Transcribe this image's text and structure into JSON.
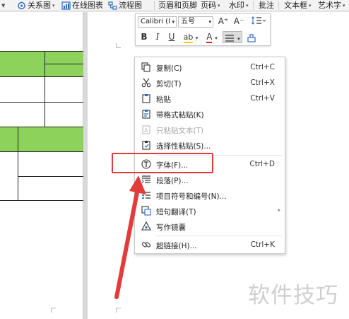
{
  "ribbon": {
    "items": [
      {
        "label": "",
        "icon": "caret-icon"
      },
      {
        "label": "关系图",
        "icon": "relation-graph-icon"
      },
      {
        "label": "在线图表",
        "icon": "online-chart-icon"
      },
      {
        "label": "流程图",
        "icon": "flowchart-icon"
      },
      {
        "label": "页眉和页脚",
        "icon": ""
      },
      {
        "label": "页码",
        "icon": ""
      },
      {
        "label": "水印",
        "icon": ""
      },
      {
        "label": "批注",
        "icon": ""
      },
      {
        "label": "文本框",
        "icon": ""
      },
      {
        "label": "艺术字",
        "icon": ""
      }
    ]
  },
  "mini_toolbar": {
    "font_name": "Calibri (I",
    "font_size": "五号",
    "buttons": {
      "grow": "A⁺",
      "shrink": "A⁻",
      "bold": "B",
      "italic": "I",
      "underline": "U",
      "highlight": "ab",
      "font_color": "A"
    }
  },
  "context_menu": {
    "items": [
      {
        "label": "复制(C)",
        "shortcut": "Ctrl+C",
        "icon": "copy-icon",
        "enabled": true
      },
      {
        "label": "剪切(T)",
        "shortcut": "Ctrl+X",
        "icon": "cut-icon",
        "enabled": true
      },
      {
        "label": "粘贴",
        "shortcut": "Ctrl+V",
        "icon": "paste-icon",
        "enabled": true
      },
      {
        "label": "带格式粘贴(K)",
        "shortcut": "",
        "icon": "paste-format-icon",
        "enabled": true
      },
      {
        "label": "只粘贴文本(T)",
        "shortcut": "",
        "icon": "paste-text-icon",
        "enabled": false
      },
      {
        "label": "选择性粘贴(S)...",
        "shortcut": "",
        "icon": "paste-special-icon",
        "enabled": true
      },
      {
        "label": "字体(F)...",
        "shortcut": "Ctrl+D",
        "icon": "font-icon",
        "enabled": true
      },
      {
        "label": "段落(P)...",
        "shortcut": "",
        "icon": "paragraph-icon",
        "enabled": true
      },
      {
        "label": "项目符号和编号(N)...",
        "shortcut": "",
        "icon": "bullets-icon",
        "enabled": true
      },
      {
        "label": "短句翻译(T)",
        "shortcut": "",
        "icon": "translate-icon",
        "enabled": true,
        "submenu": true
      },
      {
        "label": "写作镜囊",
        "shortcut": "",
        "icon": "writing-icon",
        "enabled": true
      },
      {
        "label": "超链接(H)...",
        "shortcut": "Ctrl+K",
        "icon": "hyperlink-icon",
        "enabled": true
      }
    ]
  },
  "annotation": {
    "highlight_color": "#e23b3b",
    "target_item": "字体(F)..."
  },
  "colors": {
    "table_green": "#8dd35b",
    "ribbon_bg": "#f3f3f3"
  },
  "watermark": "软件技巧"
}
